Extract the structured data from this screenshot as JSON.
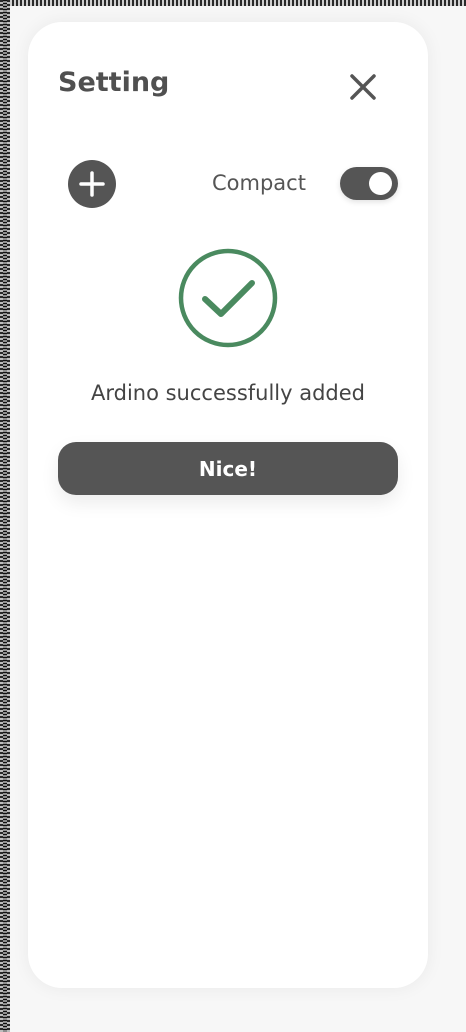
{
  "dialog": {
    "title": "Setting",
    "compact_label": "Compact",
    "compact_enabled": true,
    "message": "Ardino successfully added",
    "confirm_label": "Nice!"
  },
  "icons": {
    "close": "close-icon",
    "add": "plus-icon",
    "success": "check-circle-icon"
  },
  "colors": {
    "text": "#555555",
    "button": "#555555",
    "success": "#4a8a5f",
    "panel": "#ffffff"
  }
}
